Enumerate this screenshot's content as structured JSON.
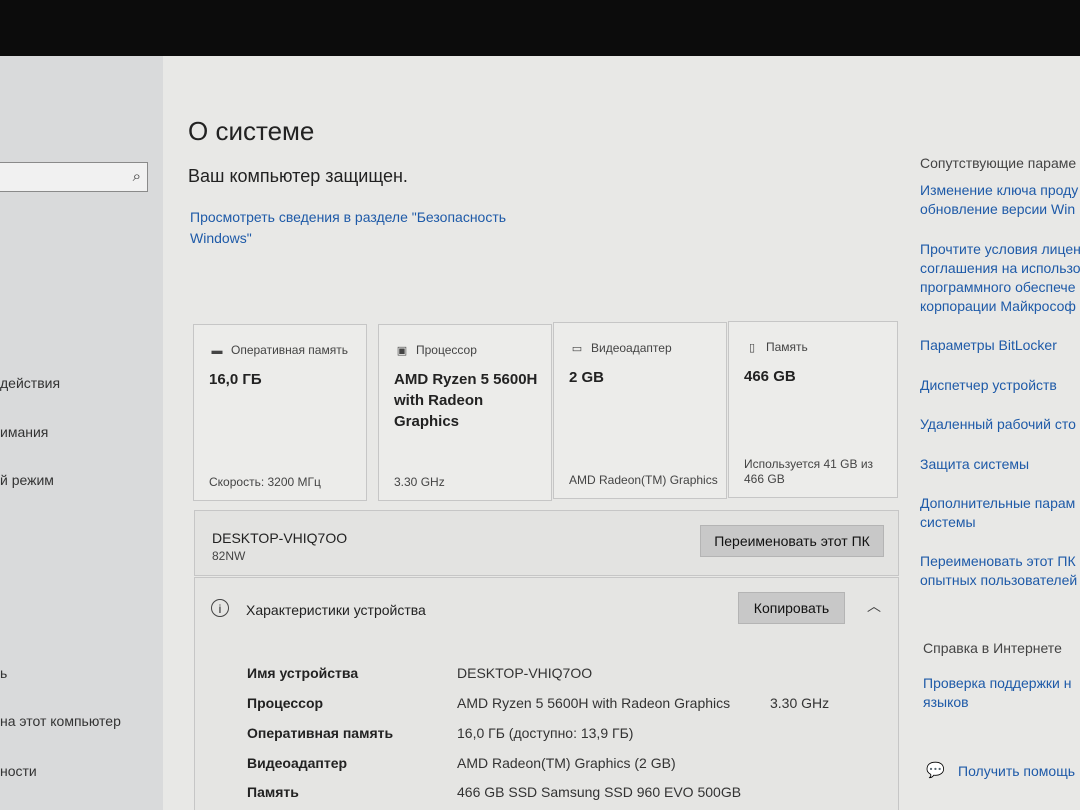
{
  "sidebar": {
    "search_icon": "search-icon",
    "items": [
      {
        "label": "действия"
      },
      {
        "label": "имания"
      },
      {
        "label": "й режим"
      },
      {
        "label": "ь"
      },
      {
        "label": "на этот компьютер"
      },
      {
        "label": "ности"
      }
    ]
  },
  "main": {
    "title": "О системе",
    "subtitle": "Ваш компьютер защищен.",
    "security_link": "Просмотреть сведения в разделе \"Безопасность Windows\"",
    "cards": [
      {
        "icon": "ram-icon",
        "label": "Оперативная память",
        "value": "16,0 ГБ",
        "footer": "Скорость: 3200 МГц"
      },
      {
        "icon": "cpu-icon",
        "label": "Процессор",
        "value": "AMD Ryzen 5 5600H with Radeon Graphics",
        "footer": "3.30 GHz"
      },
      {
        "icon": "gpu-icon",
        "label": "Видеоадаптер",
        "value": "2 GB",
        "footer": "AMD Radeon(TM) Graphics"
      },
      {
        "icon": "storage-icon",
        "label": "Память",
        "value": "466 GB",
        "footer": "Используется 41 GB из 466 GB"
      }
    ],
    "pc_name": "DESKTOP-VHIQ7OO",
    "pc_model": "82NW",
    "rename_button": "Переименовать этот ПК",
    "specs": {
      "header": "Характеристики устройства",
      "copy_button": "Копировать",
      "rows": [
        {
          "key": "Имя устройства",
          "value": "DESKTOP-VHIQ7OO",
          "extra": ""
        },
        {
          "key": "Процессор",
          "value": "AMD Ryzen 5 5600H with Radeon Graphics",
          "extra": "3.30 GHz"
        },
        {
          "key": "Оперативная память",
          "value": "16,0 ГБ (доступно: 13,9 ГБ)",
          "extra": ""
        },
        {
          "key": "Видеоадаптер",
          "value": "AMD Radeon(TM) Graphics (2 GB)",
          "extra": ""
        },
        {
          "key": "Память",
          "value": "466 GB SSD Samsung SSD 960 EVO 500GB",
          "extra": ""
        }
      ]
    }
  },
  "right": {
    "related_header": "Сопутствующие параме",
    "links": [
      "Изменение ключа проду",
      "обновление версии Win",
      "Прочтите условия лицен",
      "соглашения на использо",
      "программного обеспече",
      "корпорации Майкрософ",
      "Параметры BitLocker",
      "Диспетчер устройств",
      "Удаленный рабочий сто",
      "Защита системы",
      "Дополнительные парам",
      "системы",
      "Переименовать этот ПК",
      "опытных пользователей"
    ],
    "help_header": "Справка в Интернете",
    "help_links": [
      "Проверка поддержки н",
      "языков"
    ],
    "get_help": "Получить помощь"
  },
  "colors": {
    "link": "#1e5aa8",
    "background": "#e8e8e6",
    "sidebar": "#d9dadb"
  }
}
